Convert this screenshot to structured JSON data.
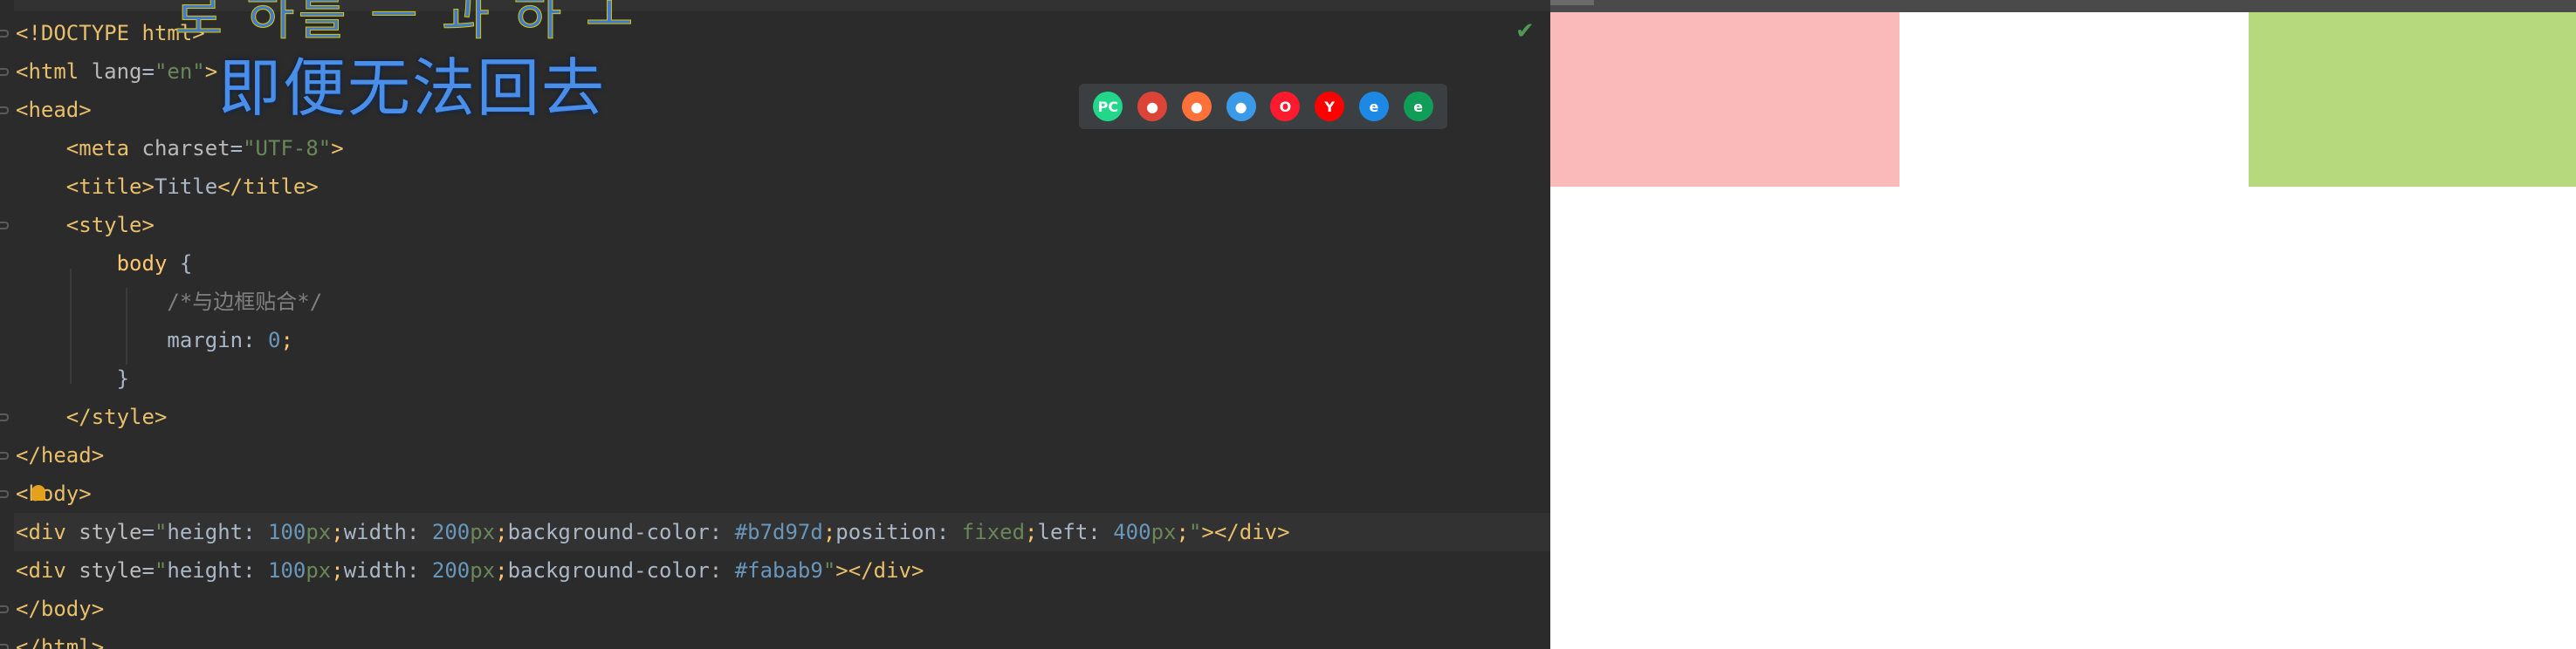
{
  "editor": {
    "lines": [
      {
        "parts": [
          [
            "tg",
            "<!DOCTYPE html>"
          ]
        ]
      },
      {
        "parts": [
          [
            "tg",
            "<html "
          ],
          [
            "at",
            "lang"
          ],
          [
            "pl",
            "="
          ],
          [
            "sv",
            "\"en\""
          ],
          [
            "tg",
            ">"
          ]
        ]
      },
      {
        "parts": [
          [
            "tg",
            "<head>"
          ]
        ]
      },
      {
        "parts": [
          [
            "pl",
            "    "
          ],
          [
            "tg",
            "<meta "
          ],
          [
            "at",
            "charset"
          ],
          [
            "pl",
            "="
          ],
          [
            "sv",
            "\"UTF-8\""
          ],
          [
            "tg",
            ">"
          ]
        ]
      },
      {
        "parts": [
          [
            "pl",
            "    "
          ],
          [
            "tg",
            "<title>"
          ],
          [
            "pl",
            "Title"
          ],
          [
            "tg",
            "</title>"
          ]
        ]
      },
      {
        "parts": [
          [
            "pl",
            "    "
          ],
          [
            "tg",
            "<style>"
          ]
        ]
      },
      {
        "parts": [
          [
            "pl",
            "        "
          ],
          [
            "kw",
            "body"
          ],
          [
            "pl",
            " {"
          ]
        ]
      },
      {
        "parts": [
          [
            "pl",
            "            "
          ],
          [
            "cm",
            "/*与边框贴合*/"
          ]
        ]
      },
      {
        "parts": [
          [
            "pl",
            "            margin: "
          ],
          [
            "num",
            "0"
          ],
          [
            "kw",
            ";"
          ]
        ]
      },
      {
        "parts": [
          [
            "pl",
            "        }"
          ]
        ]
      },
      {
        "parts": [
          [
            "pl",
            "    "
          ],
          [
            "tg",
            "</style>"
          ]
        ]
      },
      {
        "parts": [
          [
            "tg",
            "</head>"
          ]
        ]
      },
      {
        "parts": [
          [
            "tg",
            "<body>"
          ]
        ]
      },
      {
        "parts": [
          [
            "tg",
            "<div "
          ],
          [
            "at",
            "style"
          ],
          [
            "pl",
            "="
          ],
          [
            "sv",
            "\""
          ],
          [
            "pl",
            "height: "
          ],
          [
            "num",
            "100"
          ],
          [
            "sv",
            "px"
          ],
          [
            "kw",
            ";"
          ],
          [
            "pl",
            "width: "
          ],
          [
            "num",
            "200"
          ],
          [
            "sv",
            "px"
          ],
          [
            "kw",
            ";"
          ],
          [
            "pl",
            "background-color: "
          ],
          [
            "hex",
            "#b7d97d"
          ],
          [
            "kw",
            ";"
          ],
          [
            "pl",
            "position: "
          ],
          [
            "sv",
            "fixed"
          ],
          [
            "kw",
            ";"
          ],
          [
            "pl",
            "left: "
          ],
          [
            "num",
            "400"
          ],
          [
            "sv",
            "px"
          ],
          [
            "kw",
            ";"
          ],
          [
            "sv",
            "\""
          ],
          [
            "tg",
            "></div>"
          ]
        ]
      },
      {
        "parts": [
          [
            "tg",
            "<div "
          ],
          [
            "at",
            "style"
          ],
          [
            "pl",
            "="
          ],
          [
            "sv",
            "\""
          ],
          [
            "pl",
            "height: "
          ],
          [
            "num",
            "100"
          ],
          [
            "sv",
            "px"
          ],
          [
            "kw",
            ";"
          ],
          [
            "pl",
            "width: "
          ],
          [
            "num",
            "200"
          ],
          [
            "sv",
            "px"
          ],
          [
            "kw",
            ";"
          ],
          [
            "pl",
            "background-color: "
          ],
          [
            "hex",
            "#fabab9"
          ],
          [
            "sv",
            "\""
          ],
          [
            "tg",
            "></div>"
          ]
        ]
      },
      {
        "parts": [
          [
            "tg",
            "</body>"
          ]
        ]
      },
      {
        "parts": [
          [
            "tg",
            "</html>"
          ]
        ]
      }
    ],
    "inspection_status_icon": "check-icon"
  },
  "overlay": {
    "top_text": "로 하를 ㅡ 과 하 ㅗ",
    "main_text": "即便无法回去"
  },
  "browser_bar": {
    "icons": [
      {
        "name": "pycharm-icon",
        "glyph": "PC",
        "color": "#21d789"
      },
      {
        "name": "chrome-icon",
        "glyph": "●",
        "color": "#db4437"
      },
      {
        "name": "firefox-icon",
        "glyph": "●",
        "color": "#ff7139"
      },
      {
        "name": "safari-icon",
        "glyph": "●",
        "color": "#3b9ae8"
      },
      {
        "name": "opera-icon",
        "glyph": "O",
        "color": "#ff1b2d"
      },
      {
        "name": "yandex-icon",
        "glyph": "Y",
        "color": "#ff0000"
      },
      {
        "name": "ie-icon",
        "glyph": "e",
        "color": "#1e88e5"
      },
      {
        "name": "edge-icon",
        "glyph": "e",
        "color": "#0f9d58"
      }
    ]
  },
  "preview": {
    "box_green_color": "#b7d97d",
    "box_pink_color": "#fabab9"
  }
}
